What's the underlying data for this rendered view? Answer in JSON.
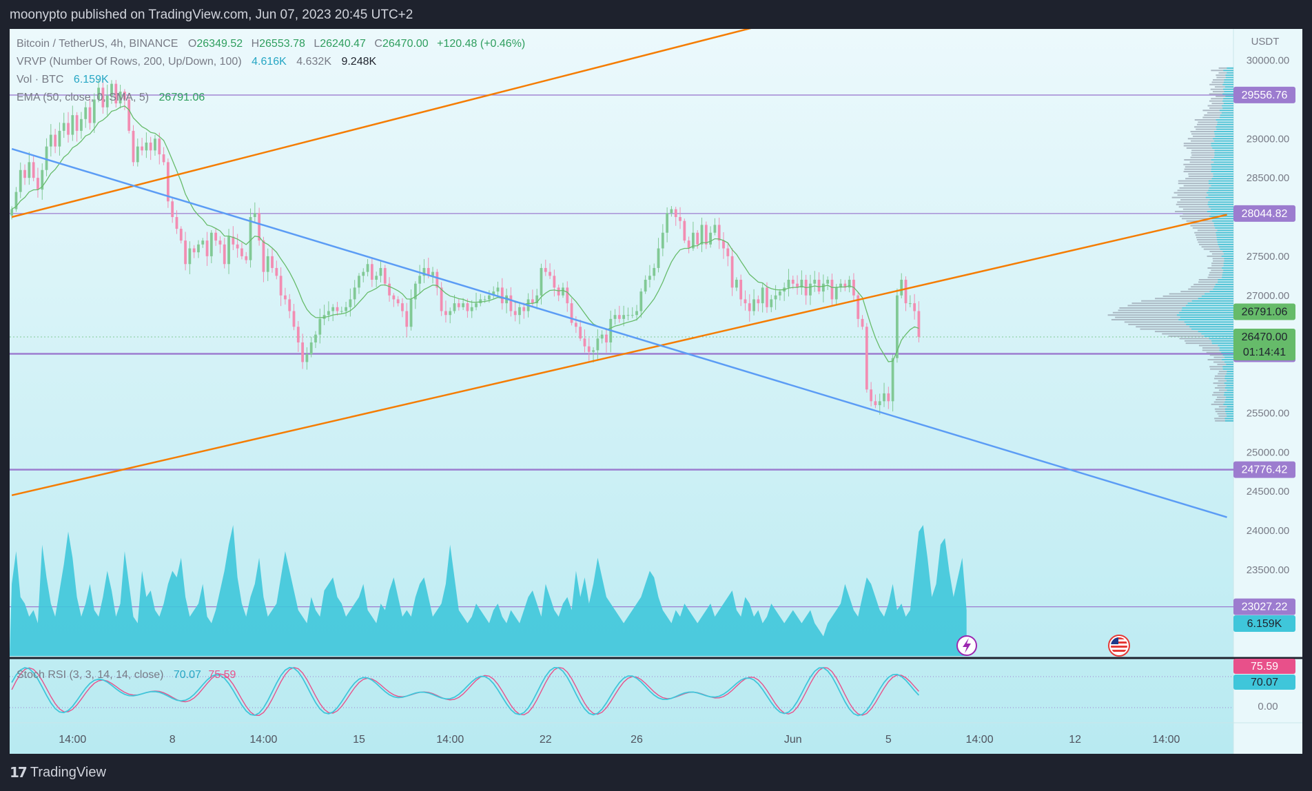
{
  "header": {
    "publisher_line": "moonypto published on TradingView.com, Jun 07, 2023 20:45 UTC+2"
  },
  "footer": {
    "logo_mark": "17",
    "logo_text": "TradingView"
  },
  "legend": {
    "symbol": "Bitcoin / TetherUS, 4h, BINANCE",
    "ohlc": [
      {
        "k": "O",
        "v": "26349.52"
      },
      {
        "k": "H",
        "v": "26553.78"
      },
      {
        "k": "L",
        "v": "26240.47"
      },
      {
        "k": "C",
        "v": "26470.00"
      }
    ],
    "change": "+120.48 (+0.46%)",
    "vrvp_label": "VRVP (Number Of Rows, 200, Up/Down, 100)",
    "vrvp_values": [
      "4.616K",
      "4.632K",
      "9.248K"
    ],
    "vol_label": "Vol · BTC",
    "vol_value": "6.159K",
    "ema_label": "EMA (50, close, 0, SMA, 5)",
    "ema_value": "26791.06",
    "stoch_label": "Stoch RSI (3, 3, 14, 14, close)",
    "stoch_k": "70.07",
    "stoch_d": "75.59"
  },
  "colors": {
    "background": "#1e222d",
    "up": "#81c995",
    "down": "#f28db2",
    "ema": "#66bb6a",
    "orange_line": "#f57c00",
    "blue_line": "#5b9cf5",
    "hline": "#9c7ccf",
    "volume": "#3fc6da",
    "stoch_k": "#3fc6da",
    "stoch_d": "#e8508a"
  },
  "chart_data": {
    "type": "candlestick",
    "symbol": "Bitcoin / TetherUS",
    "interval": "4h",
    "exchange": "BINANCE",
    "y_unit": "USDT",
    "ylim": [
      22400,
      30400
    ],
    "y_ticks": [
      {
        "value": 30000,
        "label": "30000.00"
      },
      {
        "value": 29000,
        "label": "29000.00"
      },
      {
        "value": 28500,
        "label": "28500.00"
      },
      {
        "value": 27500,
        "label": "27500.00"
      },
      {
        "value": 27000,
        "label": "27000.00"
      },
      {
        "value": 25500,
        "label": "25500.00"
      },
      {
        "value": 25000,
        "label": "25000.00"
      },
      {
        "value": 24500,
        "label": "24500.00"
      },
      {
        "value": 24000,
        "label": "24000.00"
      },
      {
        "value": 23500,
        "label": "23500.00"
      }
    ],
    "x_ticks": [
      {
        "bar": 14,
        "label": "14:00"
      },
      {
        "bar": 37,
        "label": "8"
      },
      {
        "bar": 58,
        "label": "14:00"
      },
      {
        "bar": 80,
        "label": "15"
      },
      {
        "bar": 101,
        "label": "14:00"
      },
      {
        "bar": 123,
        "label": "22"
      },
      {
        "bar": 144,
        "label": "26"
      },
      {
        "bar": 180,
        "label": "Jun"
      },
      {
        "bar": 202,
        "label": "5"
      },
      {
        "bar": 223,
        "label": "14:00"
      },
      {
        "bar": 245,
        "label": "12"
      },
      {
        "bar": 266,
        "label": "14:00"
      }
    ],
    "total_slots": 282,
    "candles_close": [
      28100,
      28320,
      28600,
      28500,
      28700,
      28500,
      28350,
      28600,
      28900,
      29050,
      28900,
      29100,
      29200,
      29050,
      29300,
      29100,
      29250,
      29400,
      29200,
      29500,
      29650,
      29400,
      29550,
      29700,
      29450,
      29600,
      29500,
      29100,
      28700,
      28900,
      28850,
      28950,
      28850,
      29000,
      28800,
      28700,
      28200,
      28000,
      27850,
      27700,
      27400,
      27600,
      27550,
      27650,
      27700,
      27500,
      27800,
      27700,
      27650,
      27400,
      27750,
      27650,
      27600,
      27500,
      27450,
      28000,
      28050,
      27700,
      27300,
      27500,
      27350,
      27250,
      27000,
      26950,
      26800,
      26600,
      26400,
      26150,
      26250,
      26400,
      26500,
      26700,
      26750,
      26800,
      26850,
      26800,
      26800,
      26850,
      26950,
      27100,
      27250,
      27300,
      27400,
      27200,
      27250,
      27350,
      27150,
      27000,
      26950,
      26900,
      26800,
      26600,
      26950,
      27150,
      27250,
      27350,
      27250,
      27300,
      27100,
      26800,
      26750,
      26800,
      26900,
      26850,
      26900,
      26800,
      26850,
      26900,
      26950,
      26950,
      27000,
      27050,
      27100,
      26900,
      27000,
      26800,
      26750,
      26850,
      26800,
      26950,
      26900,
      27000,
      27350,
      27300,
      27250,
      27100,
      27000,
      27100,
      26900,
      26650,
      26600,
      26450,
      26350,
      26280,
      26300,
      26450,
      26500,
      26400,
      26700,
      26750,
      26700,
      26750,
      26750,
      26750,
      26800,
      27050,
      27200,
      27250,
      27350,
      27600,
      27800,
      28050,
      28100,
      28000,
      27950,
      27700,
      27600,
      27800,
      27650,
      27900,
      27650,
      27800,
      27900,
      27700,
      27600,
      27500,
      27100,
      27200,
      26950,
      26900,
      26800,
      26950,
      26900,
      27100,
      26850,
      26950,
      27000,
      27050,
      27100,
      27200,
      27150,
      27100,
      27200,
      27000,
      27150,
      27200,
      27050,
      27150,
      27200,
      26950,
      27100,
      27150,
      27100,
      27200,
      27000,
      26700,
      26600,
      25800,
      25650,
      25600,
      25650,
      25750,
      25650,
      26200,
      27000,
      27200,
      26900,
      26900,
      26800,
      26470
    ],
    "price_levels": [
      {
        "value": 29556.76,
        "label": "29556.76"
      },
      {
        "value": 28044.82,
        "label": "28044.82"
      },
      {
        "value": 26254.65,
        "label": "26254.65"
      },
      {
        "value": 24776.42,
        "label": "24776.42"
      },
      {
        "value": 23027.22,
        "label": "23027.22"
      }
    ],
    "last_price": {
      "label": "26470.00",
      "countdown": "01:14:41"
    },
    "ema": {
      "label": "26791.06"
    },
    "trendlines": [
      {
        "color": "orange",
        "from": {
          "bar": 0,
          "price": 28000
        },
        "to": {
          "bar": 200,
          "price": 30830
        }
      },
      {
        "color": "orange",
        "from": {
          "bar": 0,
          "price": 24450
        },
        "to": {
          "bar": 280,
          "price": 28030
        }
      },
      {
        "color": "blue",
        "from": {
          "bar": 0,
          "price": 28870
        },
        "to": {
          "bar": 280,
          "price": 24170
        }
      }
    ],
    "volume": {
      "label": "6.159K",
      "values": [
        0.55,
        0.8,
        0.45,
        0.4,
        0.3,
        0.35,
        0.25,
        0.85,
        0.6,
        0.4,
        0.3,
        0.5,
        0.7,
        0.95,
        0.75,
        0.45,
        0.3,
        0.4,
        0.55,
        0.35,
        0.3,
        0.45,
        0.65,
        0.5,
        0.3,
        0.4,
        0.8,
        0.55,
        0.3,
        0.25,
        0.65,
        0.45,
        0.5,
        0.35,
        0.3,
        0.4,
        0.55,
        0.65,
        0.6,
        0.75,
        0.45,
        0.3,
        0.35,
        0.4,
        0.55,
        0.3,
        0.25,
        0.35,
        0.5,
        0.65,
        0.85,
        1.0,
        0.6,
        0.4,
        0.3,
        0.45,
        0.55,
        0.75,
        0.45,
        0.3,
        0.35,
        0.4,
        0.6,
        0.8,
        0.65,
        0.5,
        0.35,
        0.3,
        0.25,
        0.45,
        0.35,
        0.3,
        0.5,
        0.55,
        0.6,
        0.45,
        0.4,
        0.3,
        0.35,
        0.4,
        0.45,
        0.55,
        0.35,
        0.3,
        0.25,
        0.4,
        0.35,
        0.5,
        0.6,
        0.45,
        0.3,
        0.35,
        0.3,
        0.45,
        0.55,
        0.6,
        0.45,
        0.3,
        0.35,
        0.4,
        0.55,
        0.85,
        0.6,
        0.35,
        0.3,
        0.25,
        0.3,
        0.4,
        0.35,
        0.3,
        0.25,
        0.35,
        0.4,
        0.3,
        0.25,
        0.35,
        0.3,
        0.25,
        0.35,
        0.45,
        0.5,
        0.4,
        0.3,
        0.55,
        0.45,
        0.35,
        0.3,
        0.4,
        0.45,
        0.35,
        0.65,
        0.45,
        0.6,
        0.4,
        0.55,
        0.75,
        0.6,
        0.45,
        0.4,
        0.35,
        0.3,
        0.25,
        0.3,
        0.35,
        0.4,
        0.45,
        0.55,
        0.65,
        0.6,
        0.45,
        0.35,
        0.3,
        0.25,
        0.35,
        0.3,
        0.4,
        0.35,
        0.3,
        0.25,
        0.3,
        0.35,
        0.4,
        0.3,
        0.35,
        0.4,
        0.45,
        0.5,
        0.35,
        0.3,
        0.45,
        0.4,
        0.3,
        0.35,
        0.25,
        0.3,
        0.4,
        0.35,
        0.3,
        0.25,
        0.3,
        0.35,
        0.3,
        0.25,
        0.3,
        0.35,
        0.25,
        0.2,
        0.15,
        0.25,
        0.3,
        0.35,
        0.4,
        0.55,
        0.45,
        0.35,
        0.3,
        0.45,
        0.6,
        0.55,
        0.45,
        0.35,
        0.3,
        0.4,
        0.55,
        0.35,
        0.4,
        0.3,
        0.35,
        0.65,
        0.95,
        1.0,
        0.75,
        0.45,
        0.55,
        0.85,
        0.9,
        0.65,
        0.45,
        0.6,
        0.75,
        0.35
      ]
    },
    "stoch_rsi": {
      "label": "Stoch RSI (3, 3, 14, 14, close)",
      "k_value": "70.07",
      "d_value": "75.59",
      "ylim": [
        0,
        100
      ],
      "axis_labels": [
        {
          "value": 0,
          "label": "0.00"
        }
      ]
    }
  }
}
